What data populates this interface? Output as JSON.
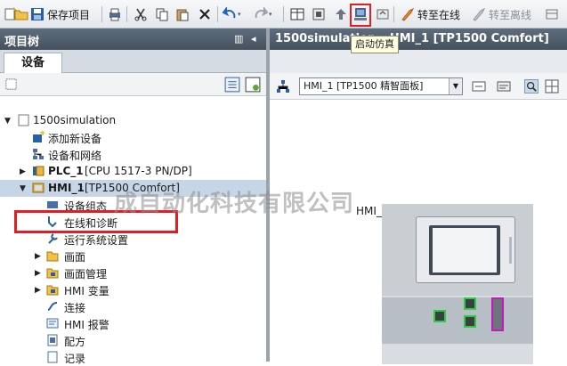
{
  "toolbar": {
    "save_project": "保存项目",
    "go_online": "转至在线",
    "go_offline": "转至离线",
    "tooltip": "启动仿真"
  },
  "left_pane": {
    "title": "项目树",
    "tab": "设备",
    "tree": [
      {
        "label": "1500simulation",
        "level": 0,
        "arrow": "down",
        "icon": "project-icon",
        "bold": false
      },
      {
        "label": "添加新设备",
        "level": 1,
        "arrow": "",
        "icon": "add-device-icon",
        "bold": false
      },
      {
        "label": "设备和网络",
        "level": 1,
        "arrow": "",
        "icon": "network-icon",
        "bold": false
      },
      {
        "label": "PLC_1",
        "sub": "[CPU 1517-3 PN/DP]",
        "level": 1,
        "arrow": "right",
        "icon": "plc-icon",
        "bold": true
      },
      {
        "label": "HMI_1",
        "sub": "[TP1500 Comfort]",
        "level": 1,
        "arrow": "down",
        "icon": "hmi-icon",
        "bold": true,
        "selected": true
      },
      {
        "label": "设备组态",
        "level": 2,
        "arrow": "",
        "icon": "device-config-icon",
        "bold": false
      },
      {
        "label": "在线和诊断",
        "level": 2,
        "arrow": "",
        "icon": "diagnostics-icon",
        "bold": false
      },
      {
        "label": "运行系统设置",
        "level": 2,
        "arrow": "",
        "icon": "runtime-settings-icon",
        "bold": false
      },
      {
        "label": "画面",
        "level": 2,
        "arrow": "right",
        "icon": "folder-icon",
        "bold": false
      },
      {
        "label": "画面管理",
        "level": 2,
        "arrow": "right",
        "icon": "folder-icon",
        "bold": false
      },
      {
        "label": "HMI 变量",
        "level": 2,
        "arrow": "right",
        "icon": "folder-icon",
        "bold": false
      },
      {
        "label": "连接",
        "level": 2,
        "arrow": "",
        "icon": "connection-icon",
        "bold": false
      },
      {
        "label": "HMI 报警",
        "level": 2,
        "arrow": "",
        "icon": "alarm-icon",
        "bold": false
      },
      {
        "label": "配方",
        "level": 2,
        "arrow": "",
        "icon": "recipe-icon",
        "bold": false
      },
      {
        "label": "记录",
        "level": 2,
        "arrow": "",
        "icon": "log-icon",
        "bold": false
      }
    ],
    "watermark": "成自动化科技有限公司"
  },
  "right_pane": {
    "title": "1500simulation ▸ HMI_1 [TP1500 Comfort]",
    "device_select": "HMI_1 [TP1500 精智面板]",
    "device_label": "HMI_1"
  }
}
